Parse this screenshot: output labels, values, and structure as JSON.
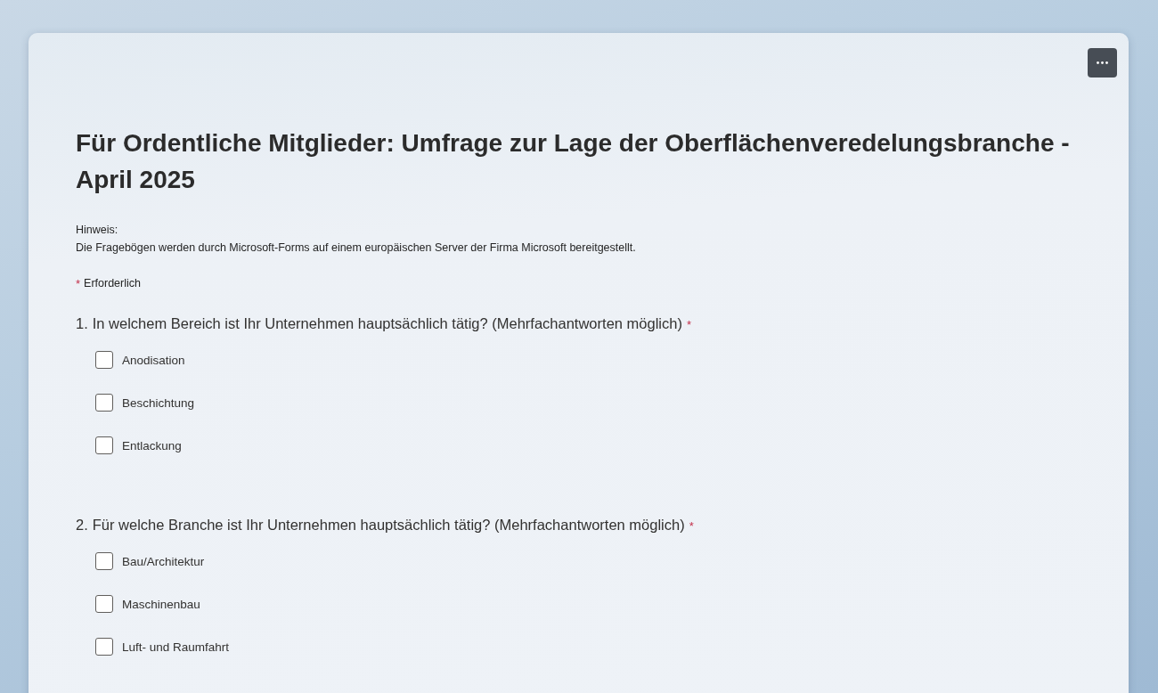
{
  "form": {
    "title": "Für Ordentliche Mitglieder: Umfrage zur Lage der Oberflächenveredelungsbranche - April 2025",
    "notice_label": "Hinweis:",
    "notice_text": "Die Fragebögen werden durch Microsoft-Forms auf einem europäischen Server der Firma Microsoft bereitgestellt.",
    "required_legend": {
      "mark": "*",
      "label": "Erforderlich"
    },
    "questions": [
      {
        "number": "1.",
        "text": "In welchem Bereich ist Ihr Unternehmen hauptsächlich tätig? (Mehrfachantworten möglich)",
        "required_mark": "*",
        "options": [
          {
            "label": "Anodisation",
            "checked": false
          },
          {
            "label": "Beschichtung",
            "checked": false
          },
          {
            "label": "Entlackung",
            "checked": false
          }
        ]
      },
      {
        "number": "2.",
        "text": "Für welche Branche ist Ihr Unternehmen hauptsächlich tätig? (Mehrfachantworten möglich)",
        "required_mark": "*",
        "options": [
          {
            "label": "Bau/Architektur",
            "checked": false
          },
          {
            "label": "Maschinenbau",
            "checked": false
          },
          {
            "label": "Luft- und Raumfahrt",
            "checked": false
          }
        ]
      }
    ]
  }
}
